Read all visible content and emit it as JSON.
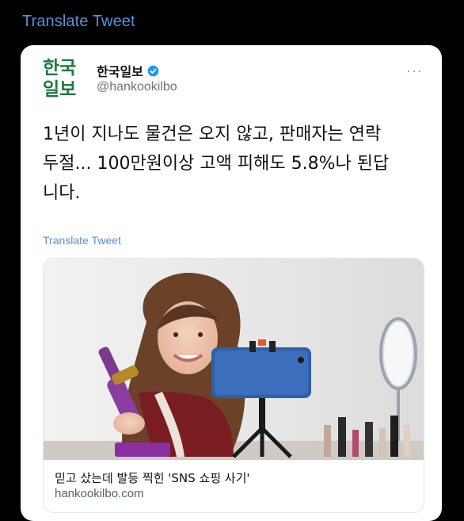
{
  "header": {
    "translate_label": "Translate Tweet"
  },
  "tweet": {
    "logo_line1": "한국",
    "logo_line2": "일보",
    "display_name": "한국일보",
    "handle": "@hankookilbo",
    "more_label": "···",
    "text_lines": [
      "1년이 지나도 물건은 오지 않고, 판매자는 연락",
      "두절... 100만원이상 고액 피해도 5.8%나 된답",
      "니다."
    ],
    "translate_label": "Translate Tweet",
    "verified_icon": "verified-badge-icon"
  },
  "link_card": {
    "title": "믿고 샀는데 발등 찍힌 'SNS 쇼핑 사기'",
    "domain": "hankookilbo.com"
  },
  "colors": {
    "background": "#000000",
    "link_blue": "#5b8fd6",
    "logo_green": "#1f7a3f",
    "verified_blue": "#1d9bf0"
  }
}
